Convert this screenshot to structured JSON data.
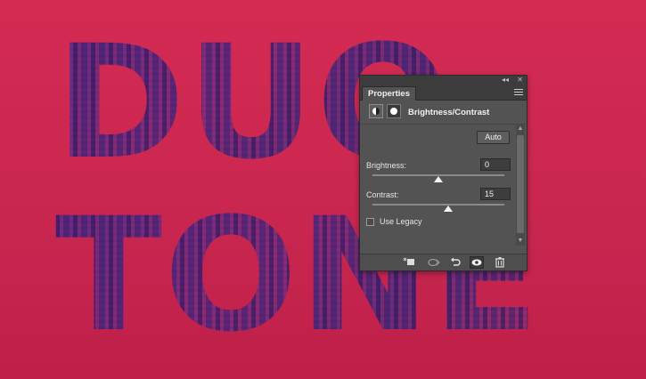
{
  "artwork": {
    "line1": "DUO",
    "line2": "TONE",
    "background_color": "#d42b53",
    "duotone_color": "#4b2c8c"
  },
  "panel": {
    "tab_label": "Properties",
    "adjustment_title": "Brightness/Contrast",
    "auto_label": "Auto",
    "brightness": {
      "label": "Brightness:",
      "value": "0",
      "slider_fraction": 0.5
    },
    "contrast": {
      "label": "Contrast:",
      "value": "15",
      "slider_fraction": 0.575
    },
    "use_legacy": {
      "label": "Use Legacy",
      "checked": false
    },
    "icons": {
      "top": [
        "collapse-icon",
        "close-icon",
        "panel-menu-icon"
      ],
      "header": [
        "brightness-contrast-adjustment-icon",
        "layer-mask-icon"
      ],
      "footer": [
        "clip-to-layer-icon",
        "view-previous-state-icon",
        "reset-icon",
        "visibility-eye-icon",
        "trash-icon"
      ]
    },
    "colors": {
      "panel_bg": "#535353",
      "tabbar_bg": "#3c3c3c"
    }
  }
}
